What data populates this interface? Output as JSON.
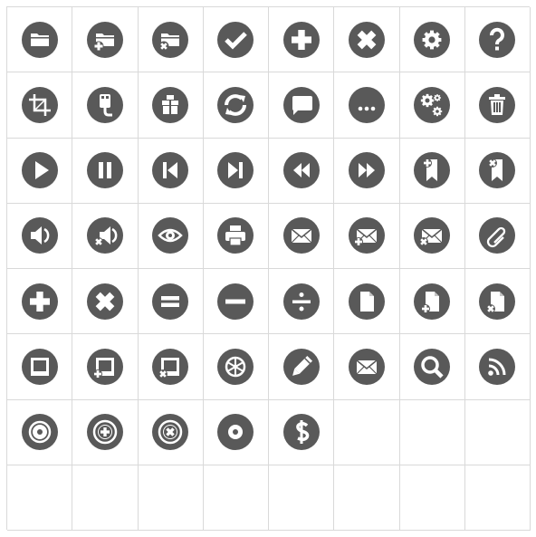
{
  "sheet": {
    "colors": {
      "circle": "#595959",
      "glyph": "#ffffff",
      "grid": "#d9d9d9"
    },
    "icons": [
      "folder-icon",
      "folder-add-icon",
      "folder-remove-icon",
      "checkmark-icon",
      "plus-icon",
      "close-icon",
      "gear-icon",
      "help-icon",
      "crop-icon",
      "usb-icon",
      "gift-icon",
      "refresh-icon",
      "chat-icon",
      "more-icon",
      "settings-icon",
      "trash-icon",
      "play-icon",
      "pause-icon",
      "step-back-icon",
      "step-forward-icon",
      "rewind-icon",
      "fast-forward-icon",
      "bookmark-add-icon",
      "bookmark-remove-icon",
      "volume-icon",
      "volume-mute-icon",
      "eye-icon",
      "printer-icon",
      "mail-icon",
      "mail-add-icon",
      "mail-remove-icon",
      "paperclip-icon",
      "add-icon",
      "remove-icon",
      "equals-icon",
      "minus-icon",
      "divide-icon",
      "document-icon",
      "document-add-icon",
      "document-remove-icon",
      "frame-icon",
      "frame-add-icon",
      "frame-remove-icon",
      "wheel-icon",
      "pencil-icon",
      "envelope-icon",
      "search-icon",
      "rss-icon",
      "disc-icon",
      "disc-add-icon",
      "disc-remove-icon",
      "cd-icon",
      "dollar-icon",
      "empty-slot",
      "empty-slot",
      "empty-slot",
      "empty-slot",
      "empty-slot",
      "empty-slot",
      "empty-slot",
      "empty-slot",
      "empty-slot",
      "empty-slot",
      "empty-slot"
    ]
  }
}
